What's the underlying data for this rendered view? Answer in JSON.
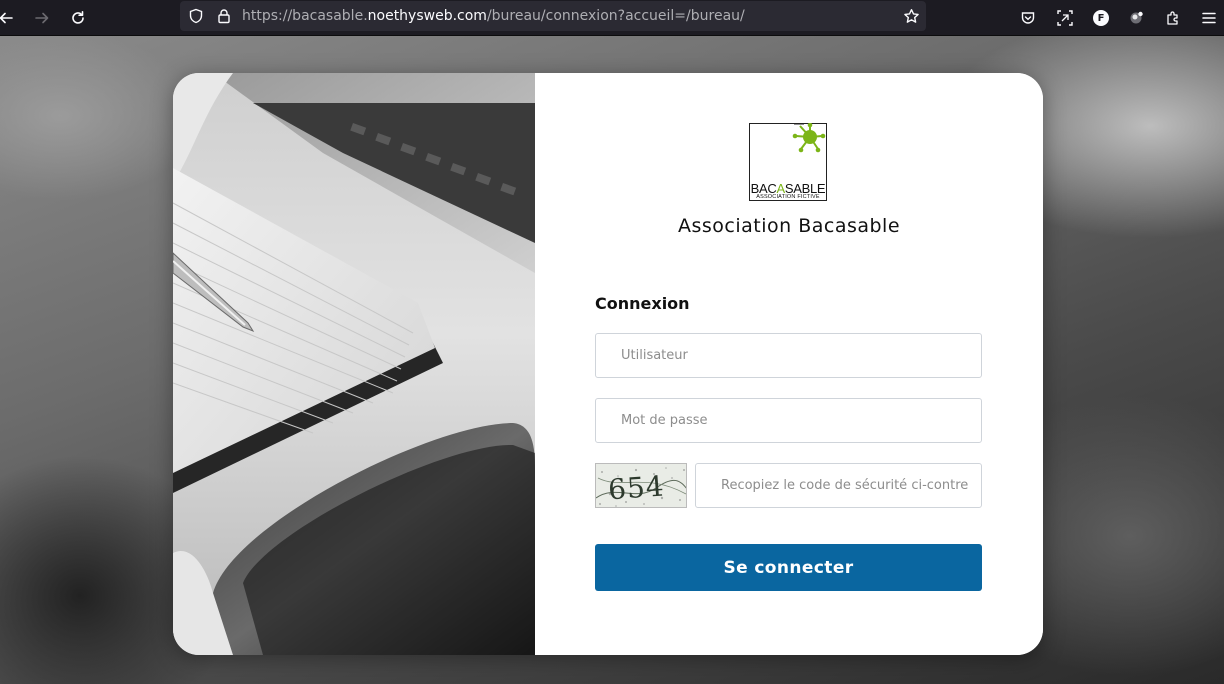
{
  "browser": {
    "url_prefix": "https://bacasable.",
    "url_domain": "noethysweb.com",
    "url_path": "/bureau/connexion?accueil=/bureau/",
    "icons": [
      "back-icon",
      "forward-icon",
      "reload-icon",
      "shield-icon",
      "lock-icon",
      "star-icon",
      "pocket-icon",
      "screenshot-icon",
      "profile-icon",
      "extension-icon",
      "puzzle-icon",
      "menu-icon"
    ],
    "profile_initial": "F"
  },
  "logo": {
    "text_before": "BAC",
    "text_accent": "A",
    "text_after": "SABLE",
    "subtitle": "ASSOCIATION FICTIVE",
    "accent_color": "#7cb518"
  },
  "organization": {
    "name": "Association Bacasable"
  },
  "login": {
    "title": "Connexion",
    "username_placeholder": "Utilisateur",
    "password_placeholder": "Mot de passe",
    "captcha_placeholder": "Recopiez le code de sécurité ci-contre",
    "captcha_code": "654",
    "submit_label": "Se connecter",
    "button_color": "#0a66a0"
  }
}
